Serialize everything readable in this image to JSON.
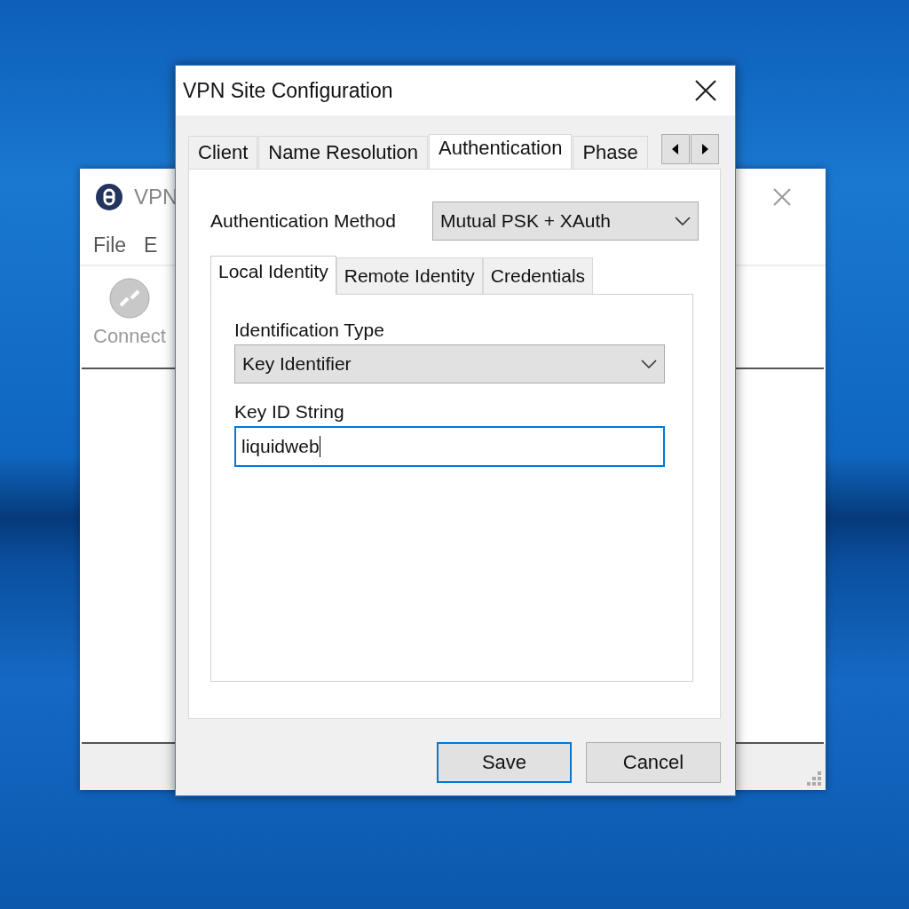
{
  "background_window": {
    "title": "VPN",
    "menu": [
      "File",
      "E"
    ],
    "toolbar": [
      {
        "label": "Connect"
      }
    ]
  },
  "dialog": {
    "title": "VPN Site Configuration",
    "tabs": [
      {
        "label": "Client",
        "selected": false
      },
      {
        "label": "Name Resolution",
        "selected": false
      },
      {
        "label": "Authentication",
        "selected": true
      },
      {
        "label": "Phase",
        "selected": false
      }
    ],
    "auth_method": {
      "label": "Authentication Method",
      "value": "Mutual PSK + XAuth"
    },
    "identity_tabs": [
      {
        "label": "Local Identity",
        "selected": true
      },
      {
        "label": "Remote Identity",
        "selected": false
      },
      {
        "label": "Credentials",
        "selected": false
      }
    ],
    "fields": [
      {
        "kind": "select",
        "label": "Identification Type",
        "value": "Key Identifier",
        "focused": false
      },
      {
        "kind": "text",
        "label": "Key ID String",
        "value": "liquidweb",
        "focused": true
      }
    ],
    "buttons": [
      {
        "label": "Save",
        "default": true
      },
      {
        "label": "Cancel",
        "default": false
      }
    ]
  }
}
